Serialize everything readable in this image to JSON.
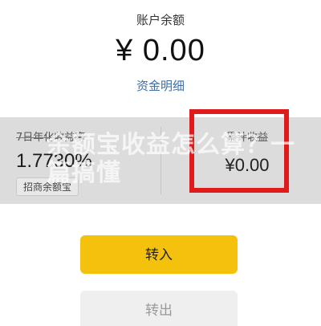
{
  "account": {
    "balance_label": "账户余额",
    "balance_amount": "¥ 0.00",
    "details_link": "资金明细"
  },
  "stats": {
    "left": {
      "label": "7日年化收益率",
      "value": "1.7730%",
      "chip": "招商余额宝"
    },
    "right": {
      "label": "累计收益",
      "value": "¥0.00"
    }
  },
  "overlay": {
    "title": "余额宝收益怎么算？一篇搞懂"
  },
  "actions": {
    "transfer_in": "转入",
    "transfer_out": "转出"
  },
  "colors": {
    "primary_button": "#f4c20d",
    "link": "#3b6ea8",
    "highlight": "#e01b1b"
  }
}
